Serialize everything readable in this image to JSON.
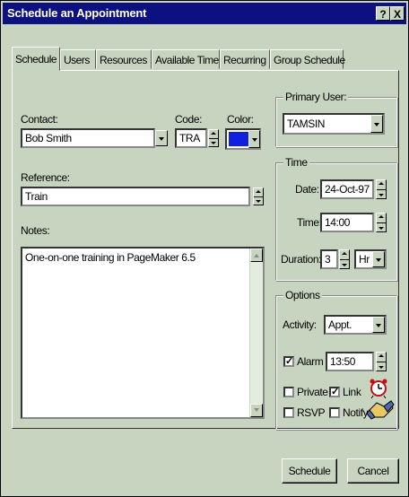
{
  "window": {
    "title": "Schedule an Appointment",
    "help_label": "?",
    "close_label": "X"
  },
  "tabs": [
    "Schedule",
    "Users",
    "Resources",
    "Available Time",
    "Recurring",
    "Group Schedule"
  ],
  "contact": {
    "label": "Contact:",
    "value": "Bob Smith"
  },
  "code": {
    "label": "Code:",
    "value": "TRA"
  },
  "color": {
    "label": "Color:",
    "value": "#1020e0"
  },
  "reference": {
    "label": "Reference:",
    "value": "Train"
  },
  "notes": {
    "label": "Notes:",
    "value": "One-on-one training in PageMaker 6.5"
  },
  "primary_user": {
    "label": "Primary User:",
    "value": "TAMSIN"
  },
  "time": {
    "group_label": "Time",
    "date_label": "Date:",
    "date_value": "24-Oct-97",
    "time_label": "Time:",
    "time_value": "14:00",
    "duration_label": "Duration:",
    "duration_value": "3",
    "unit_value": "Hr"
  },
  "options": {
    "group_label": "Options",
    "activity_label": "Activity:",
    "activity_value": "Appt.",
    "alarm_label": "Alarm",
    "alarm_checked": true,
    "alarm_value": "13:50",
    "private_label": "Private",
    "private_checked": false,
    "link_label": "Link",
    "link_checked": true,
    "rsvp_label": "RSVP",
    "rsvp_checked": false,
    "notify_label": "Notify",
    "notify_checked": false
  },
  "buttons": {
    "schedule": "Schedule",
    "cancel": "Cancel"
  },
  "check_mark": "✓",
  "icons": {
    "link": "alarm-clock-handshake-icon"
  }
}
